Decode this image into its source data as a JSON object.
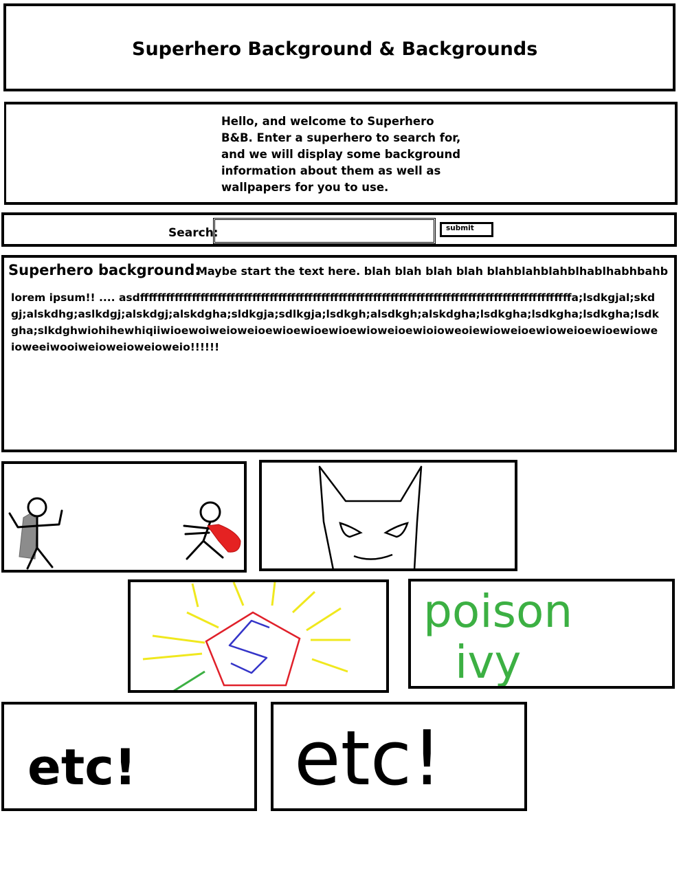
{
  "header": {
    "title": "Superhero Background & Backgrounds"
  },
  "welcome": {
    "message": "Hello, and welcome to Superhero B&B. Enter a superhero to search for, and we will display some background information about them as well as wallpapers for you to use."
  },
  "search": {
    "label": "Search:",
    "value": "",
    "placeholder": "",
    "submit_label": "submit"
  },
  "background": {
    "heading": "Superhero background:",
    "lead": "Maybe start the text here. blah blah blah blah blahblahblahblhablhabhbahb",
    "body": "lorem ipsum!! .... asdffffffffffffffffffffffffffffffffffffffffffffffffffffffffffffffffffffffffffffffffffffffffffffffffffffa;lsdkgjal;skdgj;alskdhg;aslkdgj;alskdgj;alskdgha;sldkgja;sdlkgja;lsdkgh;alsdkgh;alskdgha;lsdkgha;lsdkgha;lsdkgha;lsdkgha;slkdghwiohihewhiqiiwioewoiweioweioewioewioewioewioweioewioioweoiewioweioewioweioewioewioweioweeiwooiweioweioweioweio!!!!!!"
  },
  "wallpapers": {
    "items": [
      {
        "name": "stick-figure-heroes"
      },
      {
        "name": "batman-mask"
      },
      {
        "name": "superman-shield"
      },
      {
        "name": "poison-ivy",
        "text": "poison ivy"
      },
      {
        "name": "etc-small",
        "text": "etc!"
      },
      {
        "name": "etc-large",
        "text": "etc!"
      }
    ]
  },
  "colors": {
    "cape_red": "#e52222",
    "cape_gray": "#8c8c8c",
    "shield_red": "#e0202a",
    "shield_blue": "#3434c8",
    "rays_yellow": "#f0e81e",
    "ivy_green": "#3cb043"
  }
}
